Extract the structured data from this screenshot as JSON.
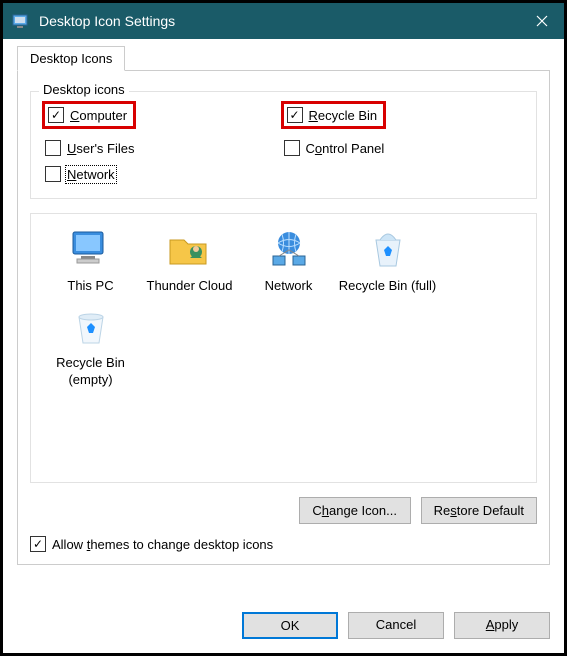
{
  "titlebar": {
    "title": "Desktop Icon Settings"
  },
  "tabs": {
    "desktop_icons": "Desktop Icons"
  },
  "group": {
    "label": "Desktop icons",
    "items": {
      "computer": {
        "label_pre": "",
        "label_u": "C",
        "label_post": "omputer",
        "checked": true,
        "highlighted": true
      },
      "recycle_bin": {
        "label_pre": "",
        "label_u": "R",
        "label_post": "ecycle Bin",
        "checked": true,
        "highlighted": true
      },
      "users_files": {
        "label_pre": "",
        "label_u": "U",
        "label_post": "ser's Files",
        "checked": false,
        "highlighted": false
      },
      "control_panel": {
        "label_pre": "C",
        "label_u": "o",
        "label_post": "ntrol Panel",
        "checked": false,
        "highlighted": false
      },
      "network": {
        "label_pre": "",
        "label_u": "N",
        "label_post": "etwork",
        "checked": false,
        "highlighted": false,
        "focused": true
      }
    }
  },
  "icons": {
    "this_pc": "This PC",
    "thunder_cloud": "Thunder Cloud",
    "network": "Network",
    "recycle_full": "Recycle Bin (full)",
    "recycle_empty": "Recycle Bin (empty)"
  },
  "buttons": {
    "change_icon_pre": "C",
    "change_icon_u": "h",
    "change_icon_post": "ange Icon...",
    "restore_default_pre": "Re",
    "restore_default_u": "s",
    "restore_default_post": "tore Default",
    "ok": "OK",
    "cancel": "Cancel",
    "apply_pre": "",
    "apply_u": "A",
    "apply_post": "pply"
  },
  "allow_themes": {
    "label_pre": "Allow ",
    "label_u": "t",
    "label_post": "hemes to change desktop icons",
    "checked": true
  }
}
